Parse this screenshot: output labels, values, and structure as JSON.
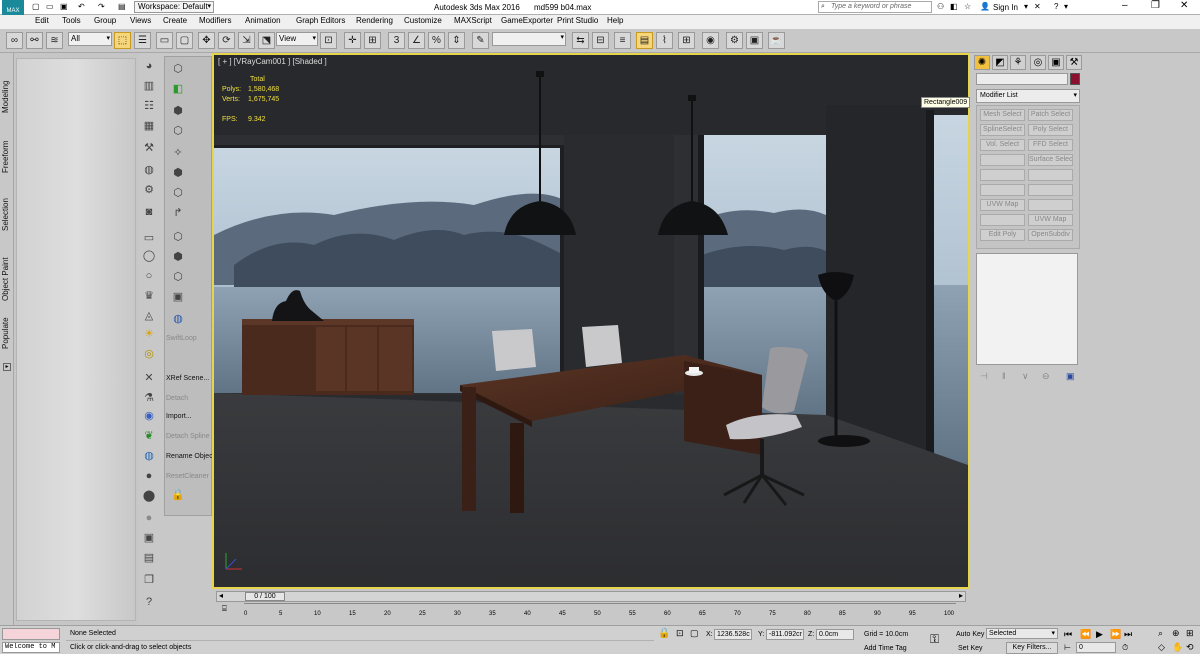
{
  "titlebar": {
    "logo": "MAX",
    "workspace": "Workspace: Default",
    "app_title": "Autodesk 3ds Max 2016",
    "file_name": "md599 b04.max",
    "search_placeholder": "Type a keyword or phrase",
    "sign_in": "Sign In"
  },
  "menu": [
    "Edit",
    "Tools",
    "Group",
    "Views",
    "Create",
    "Modifiers",
    "Animation",
    "Graph Editors",
    "Rendering",
    "Customize",
    "MAXScript",
    "GameExporter",
    "Print Studio",
    "Help"
  ],
  "toolbar": {
    "selection_filter": "All",
    "reference_coord": "View",
    "named_selection": ""
  },
  "ribbon_tabs": [
    "Modeling",
    "Freeform",
    "Selection",
    "Object Paint",
    "Populate"
  ],
  "panel_items": [
    {
      "label": "SwiftLoop",
      "dim": true
    },
    {
      "label": "XRef Scene...",
      "dim": false
    },
    {
      "label": "Detach",
      "dim": true
    },
    {
      "label": "Import...",
      "dim": false
    },
    {
      "label": "Detach Spline",
      "dim": true
    },
    {
      "label": "Rename Objects",
      "dim": false
    },
    {
      "label": "ResetCleaner",
      "dim": true
    }
  ],
  "viewport": {
    "label": "[ + ] [VRayCam001 ] [Shaded ]",
    "stats": {
      "total_label": "Total",
      "polys_label": "Polys:",
      "polys_value": "1,580,468",
      "verts_label": "Verts:",
      "verts_value": "1,675,745",
      "fps_label": "FPS:",
      "fps_value": "9.342"
    },
    "tooltip": "Rectangle009",
    "colors": {
      "border": "#e6d44a",
      "stats": "#f0e040"
    }
  },
  "command_panel": {
    "modifier_list": "Modifier List",
    "buttons": [
      [
        "Mesh Select",
        "Patch Select"
      ],
      [
        "SplineSelect",
        "Poly Select"
      ],
      [
        "Vol. Select",
        "FFD Select"
      ],
      [
        "",
        "Surface Select"
      ],
      [
        "",
        ""
      ],
      [
        "",
        ""
      ],
      [
        "UVW Map",
        ""
      ],
      [
        "",
        "UVW Map"
      ],
      [
        "Edit Poly",
        "OpenSubdiv"
      ]
    ]
  },
  "timeline": {
    "frame_indicator": "0 / 100",
    "ticks": [
      "0",
      "5",
      "10",
      "15",
      "20",
      "25",
      "30",
      "35",
      "40",
      "45",
      "50",
      "55",
      "60",
      "65",
      "70",
      "75",
      "80",
      "85",
      "90",
      "95",
      "100"
    ]
  },
  "statusbar": {
    "maxscript_listener": "Welcome to M",
    "selection_status": "None Selected",
    "prompt": "Click or click-and-drag to select objects",
    "x_label": "X:",
    "x_value": "1236.528c",
    "y_label": "Y:",
    "y_value": "-811.092cr",
    "z_label": "Z:",
    "z_value": "0.0cm",
    "grid": "Grid = 10.0cm",
    "add_time_tag": "Add Time Tag",
    "auto_key": "Auto Key",
    "set_key": "Set Key",
    "selected": "Selected",
    "key_filters": "Key Filters...",
    "frame": "0"
  }
}
